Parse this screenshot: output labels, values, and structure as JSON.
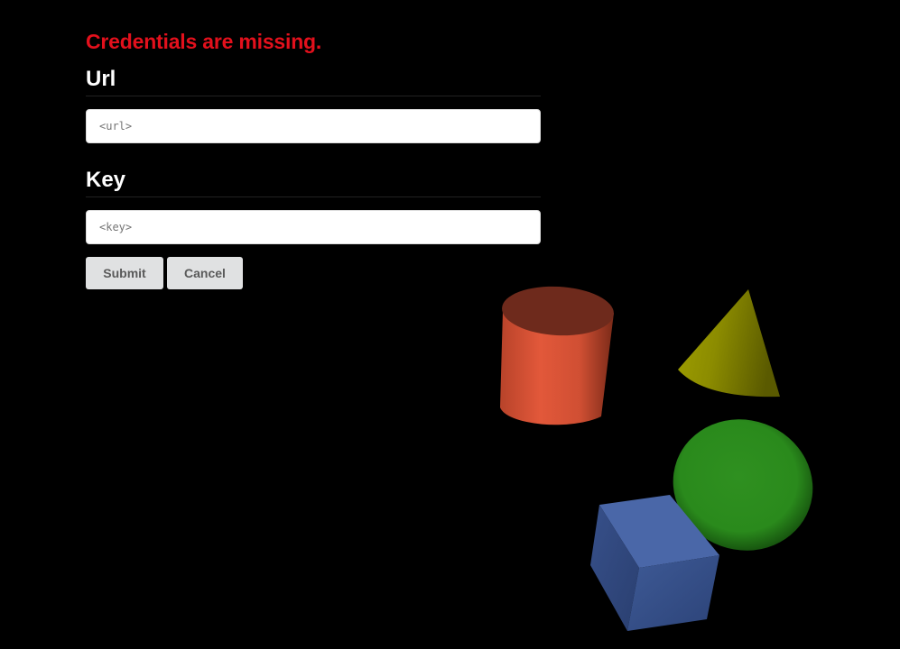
{
  "form": {
    "error_message": "Credentials are missing.",
    "url": {
      "title": "Url",
      "placeholder": "<url>",
      "value": ""
    },
    "key": {
      "title": "Key",
      "placeholder": "<key>",
      "value": ""
    },
    "buttons": {
      "submit_label": "Submit",
      "cancel_label": "Cancel"
    }
  },
  "colors": {
    "background": "#000000",
    "error": "#e3101c",
    "cylinder": "#e05535",
    "cone": "#8a8a00",
    "sphere": "#2e8a1e",
    "cube": "#4563a3"
  },
  "scene": {
    "objects": [
      "cylinder",
      "cone",
      "sphere",
      "cube"
    ]
  }
}
